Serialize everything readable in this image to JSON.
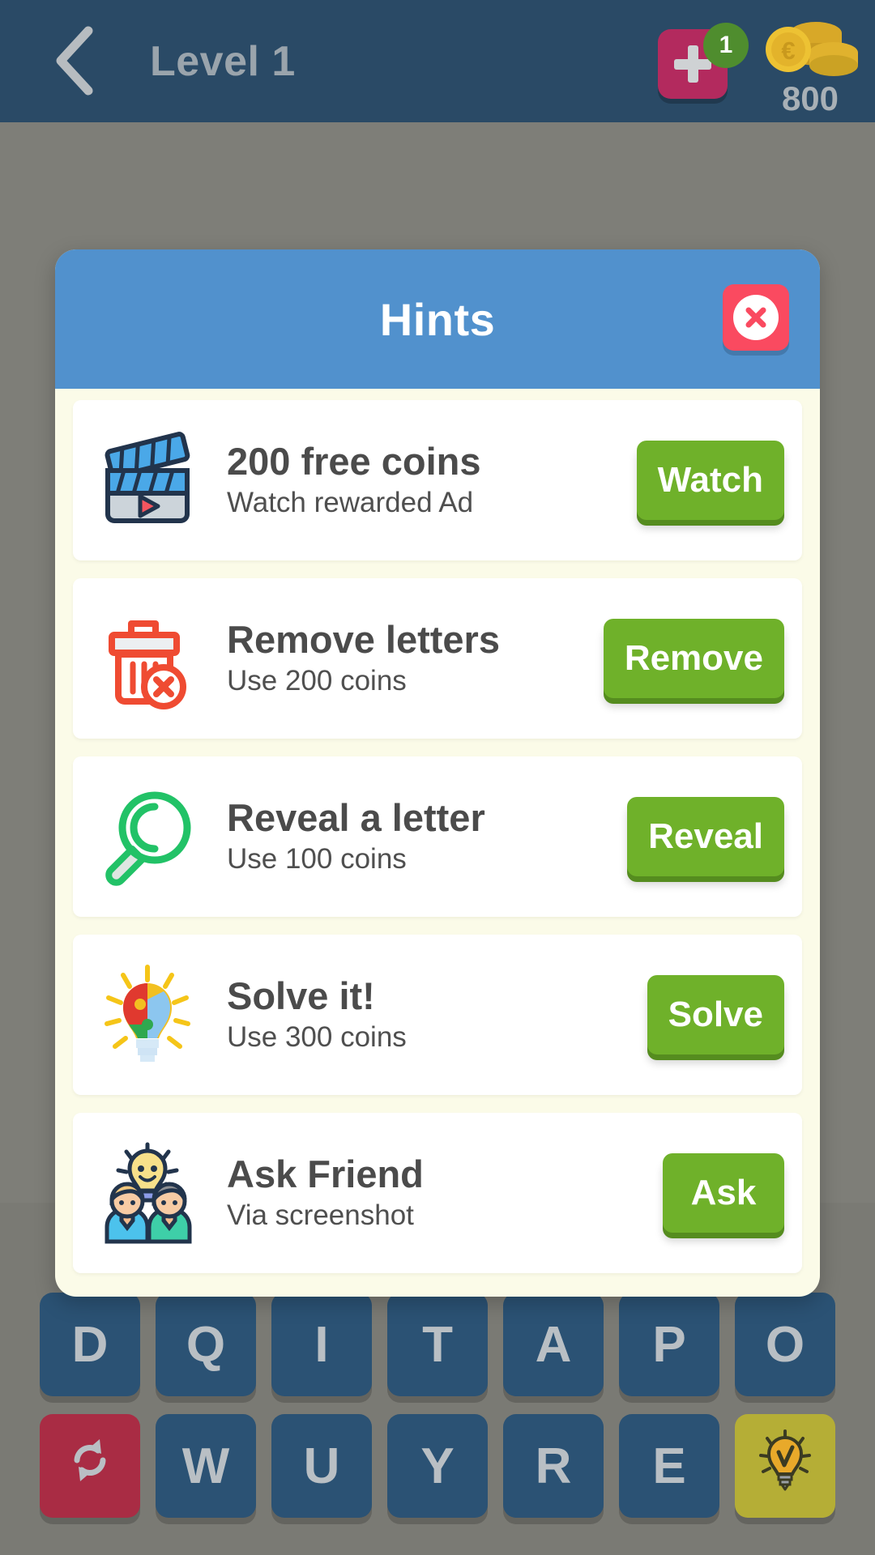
{
  "topbar": {
    "back_icon": "chevron-left-icon",
    "title": "Level 1",
    "add_button": {
      "icon": "plus-icon",
      "badge": "1"
    },
    "coins": {
      "icon": "coin-stack-icon",
      "amount": "800"
    }
  },
  "modal": {
    "title": "Hints",
    "close_icon": "close-x-icon",
    "hints": [
      {
        "icon": "clapperboard-icon",
        "title": "200 free coins",
        "subtitle": "Watch rewarded Ad",
        "button": "Watch"
      },
      {
        "icon": "trash-delete-icon",
        "title": "Remove letters",
        "subtitle": "Use 200 coins",
        "button": "Remove"
      },
      {
        "icon": "magnifier-icon",
        "title": "Reveal a letter",
        "subtitle": "Use 100 coins",
        "button": "Reveal"
      },
      {
        "icon": "puzzle-bulb-icon",
        "title": "Solve it!",
        "subtitle": "Use 300 coins",
        "button": "Solve"
      },
      {
        "icon": "two-people-bulb-icon",
        "title": "Ask Friend",
        "subtitle": "Via screenshot",
        "button": "Ask"
      }
    ]
  },
  "keyboard": {
    "row1": [
      "D",
      "Q",
      "I",
      "T",
      "A",
      "P",
      "O"
    ],
    "row2": [
      "W",
      "U",
      "Y",
      "R",
      "E"
    ],
    "shuffle_icon": "shuffle-icon",
    "hint_icon": "lightbulb-icon"
  },
  "colors": {
    "header_bg": "#2a4a66",
    "modal_header_bg": "#5191cd",
    "modal_bg": "#fbfbe8",
    "button_green": "#6fb12a",
    "close_red": "#fa4a60",
    "plus_pink": "#b32a5e",
    "badge_green": "#4f8d2e",
    "key_blue": "#2b5274",
    "shuffle_red": "#a92c44",
    "bulb_olive": "#b5ae36"
  }
}
